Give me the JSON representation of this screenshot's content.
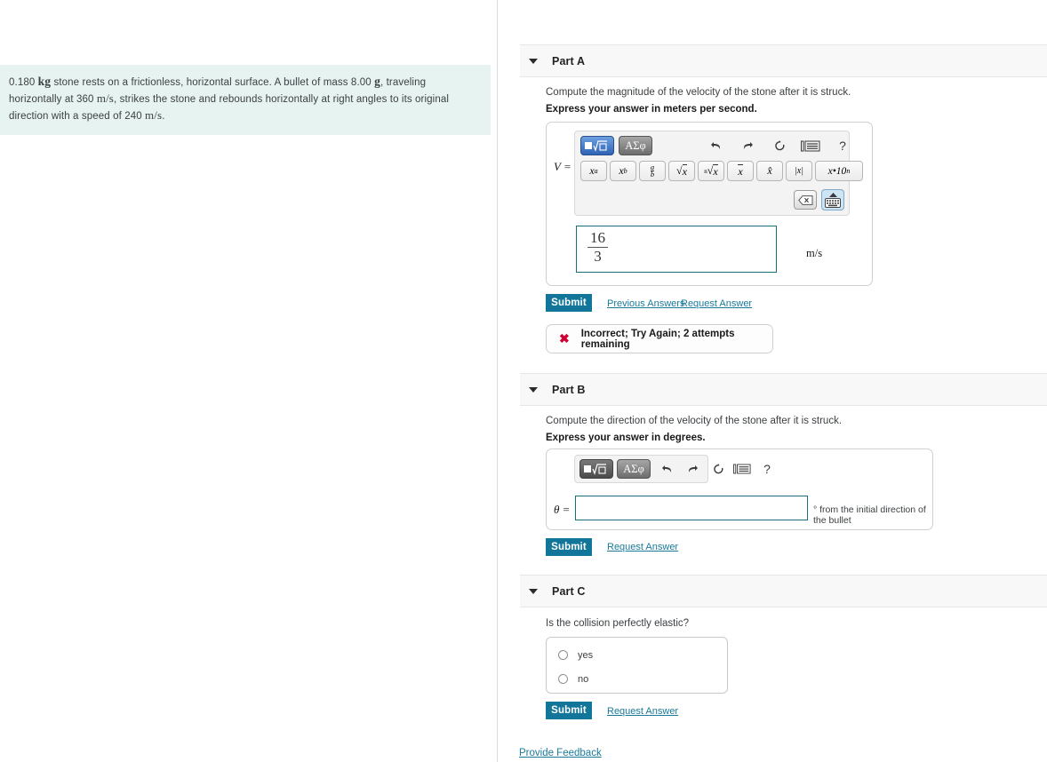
{
  "problem": {
    "segments": [
      {
        "t": "0.180 ",
        "s": "plain"
      },
      {
        "t": "kg",
        "s": "mathb"
      },
      {
        "t": " stone rests on a frictionless, horizontal surface. A bullet of mass 8.00 ",
        "s": "plain"
      },
      {
        "t": "g",
        "s": "mathb"
      },
      {
        "t": ", traveling horizontally at 360 ",
        "s": "plain"
      },
      {
        "t": "m/s",
        "s": "mathi"
      },
      {
        "t": ", strikes the stone and rebounds horizontally at right angles to its original direction with a speed of 240 ",
        "s": "plain"
      },
      {
        "t": "m/s",
        "s": "mathi"
      },
      {
        "t": ".",
        "s": "plain"
      }
    ]
  },
  "parts": {
    "a": {
      "title": "Part A",
      "prompt": "Compute the magnitude of the velocity of the stone after it is struck.",
      "instruction": "Express your answer in meters per second.",
      "variable": "V =",
      "answer_numerator": "16",
      "answer_denominator": "3",
      "unit": "m/s",
      "submit_label": "Submit",
      "previous_answers_label": "Previous Answers",
      "request_answer_label": "Request Answer",
      "feedback": "Incorrect; Try Again; 2 attempts remaining"
    },
    "b": {
      "title": "Part B",
      "prompt": "Compute the direction of the velocity of the stone after it is struck.",
      "instruction": "Express your answer in degrees.",
      "variable": "θ =",
      "answer_value": "",
      "suffix": "° from the initial direction of the bullet",
      "submit_label": "Submit",
      "request_answer_label": "Request Answer"
    },
    "c": {
      "title": "Part C",
      "prompt": "Is the collision perfectly elastic?",
      "options": [
        "yes",
        "no"
      ],
      "submit_label": "Submit",
      "request_answer_label": "Request Answer"
    }
  },
  "toolbar": {
    "mode_template_label": "√☐",
    "mode_greek_label": "ΑΣφ",
    "undo": "↶",
    "redo": "↷",
    "reset": "↺",
    "keypad": "⌨",
    "help": "?",
    "keys": [
      {
        "id": "superscript",
        "label": "x",
        "sup": "a"
      },
      {
        "id": "subscript",
        "label": "x",
        "sub": "b"
      },
      {
        "id": "fraction",
        "num": "a",
        "den": "b"
      },
      {
        "id": "sqrt",
        "label": "√x"
      },
      {
        "id": "nth-root",
        "label": "ⁿ√x"
      },
      {
        "id": "vector",
        "label": "x⃗"
      },
      {
        "id": "hat",
        "label": "x̂"
      },
      {
        "id": "absolute",
        "label": "|x|"
      },
      {
        "id": "scientific",
        "label": "x•10ⁿ"
      }
    ],
    "backspace": "⌫",
    "keyboard": "keyboard"
  },
  "footer": {
    "provide_feedback_label": "Provide Feedback"
  },
  "colors": {
    "accent": "#12769a",
    "link": "#1a7a99",
    "problem_bg": "#e7f3f1",
    "error": "#cc0033",
    "input_border": "#1a6b7c"
  }
}
